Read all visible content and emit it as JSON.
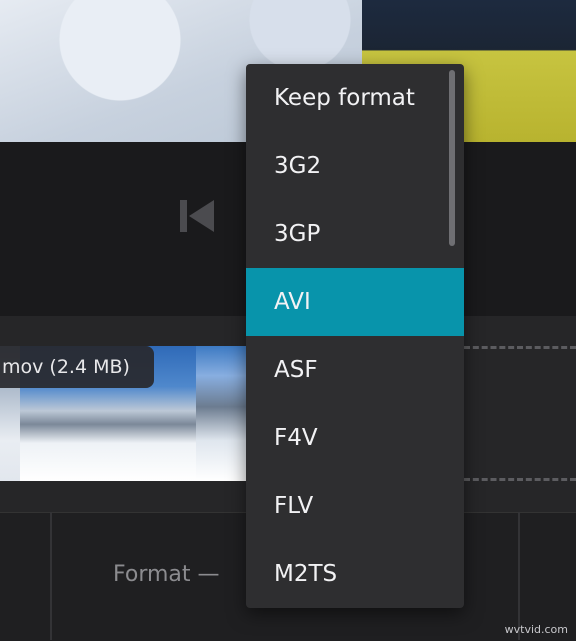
{
  "timeline": {
    "file_label": "mov (2.4 MB)"
  },
  "settings": {
    "format_label": "Format —"
  },
  "format_dropdown": {
    "selected": "AVI",
    "options": [
      "Keep format",
      "3G2",
      "3GP",
      "AVI",
      "ASF",
      "F4V",
      "FLV",
      "M2TS"
    ]
  },
  "icons": {
    "previous": "skip-previous-icon"
  },
  "colors": {
    "selected_option_bg": "#0894ab",
    "dropdown_bg": "#2e2e30"
  },
  "watermark": "wvtvid.com"
}
